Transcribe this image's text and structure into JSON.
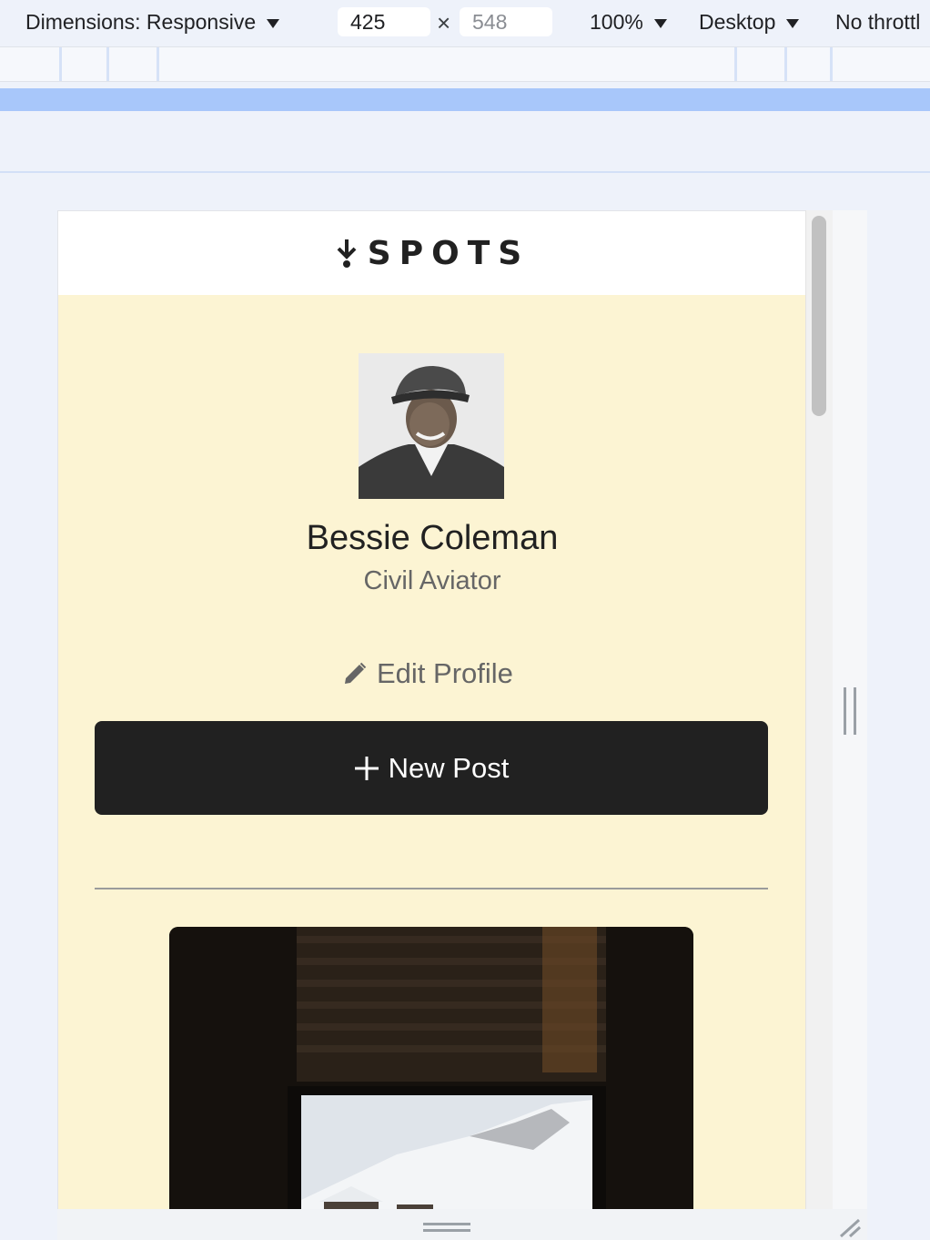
{
  "devtools": {
    "dimensions_label": "Dimensions: Responsive",
    "width_value": "425",
    "height_value": "548",
    "times_symbol": "×",
    "zoom_label": "100%",
    "device_label": "Desktop",
    "throttle_label": "No throttl"
  },
  "site": {
    "logo_text": "SPOTS",
    "profile": {
      "name": "Bessie Coleman",
      "description": "Civil Aviator",
      "edit_label": "Edit Profile"
    },
    "new_post_label": "New Post"
  },
  "icons": [
    "dropdown-caret-icon",
    "spots-logo-icon",
    "pencil-icon",
    "plus-icon",
    "resize-handle-icon"
  ]
}
